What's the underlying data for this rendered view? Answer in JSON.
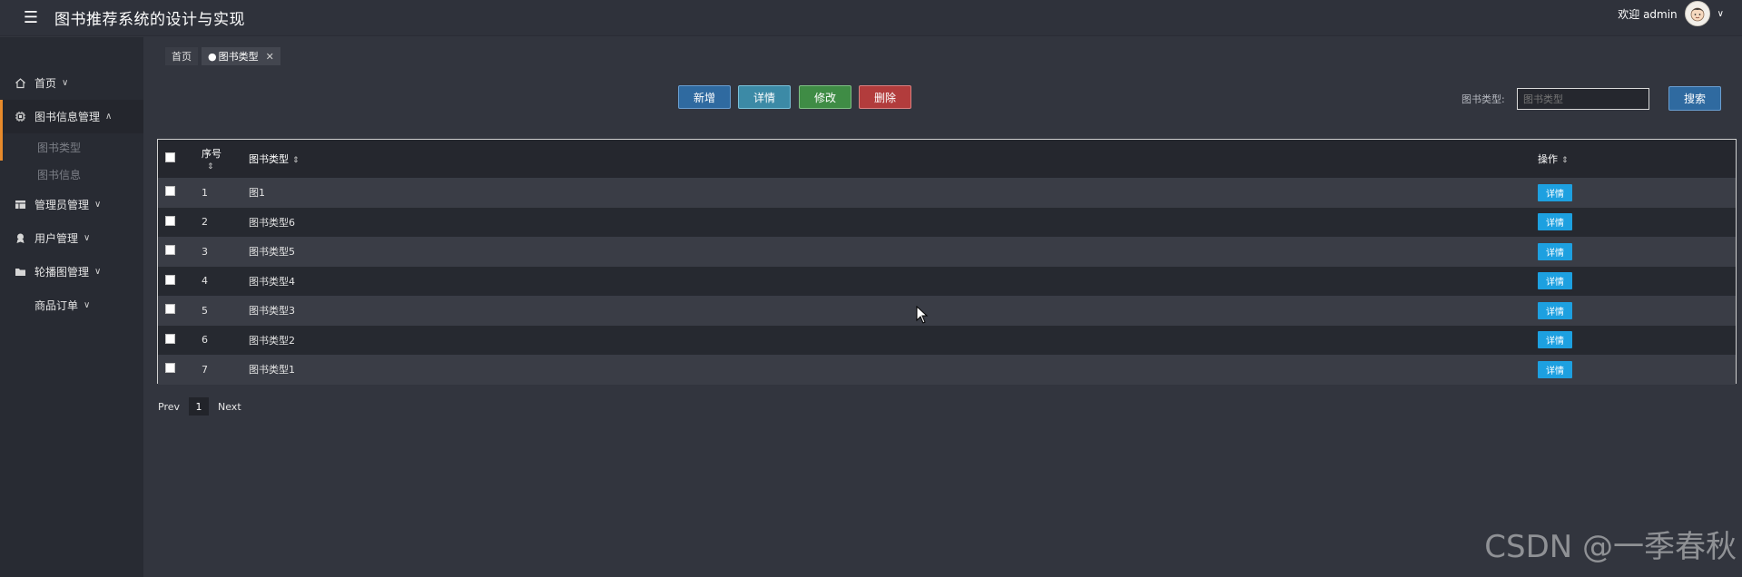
{
  "header": {
    "title": "图书推荐系统的设计与实现",
    "welcome": "欢迎 admin"
  },
  "sidebar": {
    "items": [
      {
        "label": "首页",
        "icon": "home-icon"
      },
      {
        "label": "图书信息管理",
        "icon": "chip-icon",
        "expanded": true,
        "children": [
          "图书类型",
          "图书信息"
        ]
      },
      {
        "label": "管理员管理",
        "icon": "table-icon"
      },
      {
        "label": "用户管理",
        "icon": "user-icon"
      },
      {
        "label": "轮播图管理",
        "icon": "folder-icon"
      },
      {
        "label": "商品订单",
        "icon": ""
      }
    ]
  },
  "tabs": {
    "home": "首页",
    "current": "图书类型"
  },
  "toolbar": {
    "add": "新增",
    "detail": "详情",
    "edit": "修改",
    "delete": "删除"
  },
  "search": {
    "label": "图书类型:",
    "placeholder": "图书类型",
    "button": "搜索"
  },
  "table": {
    "columns": [
      "序号",
      "图书类型",
      "操作"
    ],
    "rows": [
      {
        "index": "1",
        "type": "图1",
        "action": "详情"
      },
      {
        "index": "2",
        "type": "图书类型6",
        "action": "详情"
      },
      {
        "index": "3",
        "type": "图书类型5",
        "action": "详情"
      },
      {
        "index": "4",
        "type": "图书类型4",
        "action": "详情"
      },
      {
        "index": "5",
        "type": "图书类型3",
        "action": "详情"
      },
      {
        "index": "6",
        "type": "图书类型2",
        "action": "详情"
      },
      {
        "index": "7",
        "type": "图书类型1",
        "action": "详情"
      }
    ]
  },
  "pager": {
    "prev": "Prev",
    "page": "1",
    "next": "Next"
  },
  "watermark": "CSDN @一季春秋",
  "colors": {
    "accent": "#e78a2b",
    "primary": "#2f6aa0",
    "info": "#1da0e0",
    "success": "#3f8c45",
    "danger": "#b23c3c"
  }
}
